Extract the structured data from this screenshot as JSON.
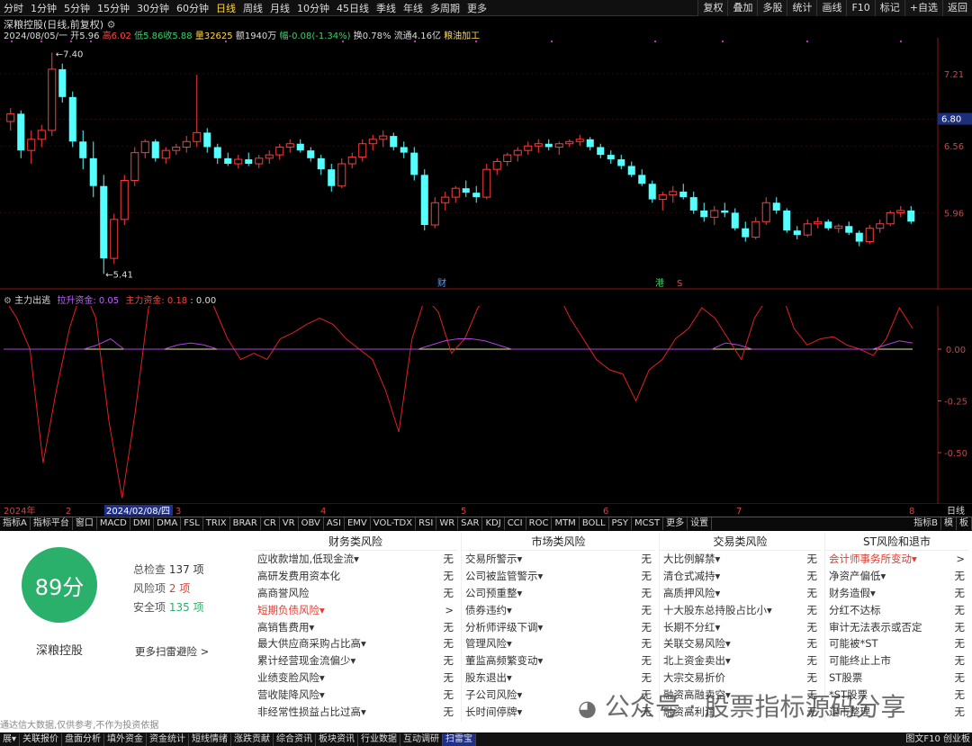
{
  "toolbar": {
    "periods": [
      "分时",
      "1分钟",
      "5分钟",
      "15分钟",
      "30分钟",
      "60分钟",
      "日线",
      "周线",
      "月线",
      "10分钟",
      "45日线",
      "季线",
      "年线",
      "多周期",
      "更多"
    ],
    "active_period": "日线",
    "right_buttons": [
      "复权",
      "叠加",
      "多股",
      "统计",
      "画线",
      "F10",
      "标记",
      "+自选",
      "返回"
    ]
  },
  "quote": {
    "title": "深粮控股(日线,前复权)",
    "date": "2024/08/05/一",
    "open": "开5.96",
    "high": "高6.02",
    "low": "低5.86",
    "close": "收5.88",
    "volume": "量32625",
    "amount": "额1940万",
    "change": "幅-0.08(-1.34%)",
    "turnover": "换0.78%",
    "float": "流通4.16亿",
    "industry": "粮油加工"
  },
  "price_axis": {
    "ticks": [
      "7.21",
      "6.80",
      "6.56",
      "5.96"
    ],
    "current_price": "6.80",
    "high_label": "7.40",
    "low_label": "5.41"
  },
  "chart_data": {
    "type": "candlestick",
    "ylim": [
      5.3,
      7.5
    ],
    "ohlc": [
      [
        6.78,
        6.9,
        6.7,
        6.85
      ],
      [
        6.85,
        6.88,
        6.45,
        6.52
      ],
      [
        6.52,
        6.7,
        6.4,
        6.62
      ],
      [
        6.62,
        6.75,
        6.55,
        6.7
      ],
      [
        6.7,
        7.4,
        6.65,
        7.25
      ],
      [
        7.25,
        7.3,
        6.95,
        7.0
      ],
      [
        7.0,
        7.05,
        6.55,
        6.6
      ],
      [
        6.6,
        6.7,
        6.35,
        6.45
      ],
      [
        6.45,
        6.6,
        6.1,
        6.2
      ],
      [
        6.2,
        6.3,
        5.41,
        5.55
      ],
      [
        5.55,
        5.95,
        5.5,
        5.9
      ],
      [
        5.9,
        6.3,
        5.85,
        6.25
      ],
      [
        6.25,
        6.55,
        6.2,
        6.5
      ],
      [
        6.5,
        6.62,
        6.45,
        6.6
      ],
      [
        6.6,
        6.62,
        6.42,
        6.45
      ],
      [
        6.45,
        6.55,
        6.4,
        6.52
      ],
      [
        6.52,
        6.58,
        6.48,
        6.55
      ],
      [
        6.55,
        6.65,
        6.5,
        6.6
      ],
      [
        6.6,
        7.2,
        6.55,
        6.68
      ],
      [
        6.68,
        6.72,
        6.5,
        6.55
      ],
      [
        6.55,
        6.58,
        6.4,
        6.45
      ],
      [
        6.45,
        6.5,
        6.38,
        6.4
      ],
      [
        6.4,
        6.48,
        6.36,
        6.44
      ],
      [
        6.44,
        6.5,
        6.38,
        6.4
      ],
      [
        6.4,
        6.48,
        6.36,
        6.45
      ],
      [
        6.45,
        6.52,
        6.4,
        6.48
      ],
      [
        6.48,
        6.58,
        6.44,
        6.55
      ],
      [
        6.55,
        6.62,
        6.5,
        6.58
      ],
      [
        6.58,
        6.62,
        6.5,
        6.52
      ],
      [
        6.52,
        6.55,
        6.42,
        6.45
      ],
      [
        6.45,
        6.48,
        6.3,
        6.35
      ],
      [
        6.35,
        6.4,
        6.15,
        6.2
      ],
      [
        6.2,
        6.45,
        6.18,
        6.4
      ],
      [
        6.4,
        6.5,
        6.36,
        6.46
      ],
      [
        6.46,
        6.62,
        6.42,
        6.58
      ],
      [
        6.58,
        6.66,
        6.52,
        6.62
      ],
      [
        6.62,
        6.7,
        6.55,
        6.65
      ],
      [
        6.65,
        6.68,
        6.52,
        6.55
      ],
      [
        6.55,
        6.6,
        6.45,
        6.5
      ],
      [
        6.5,
        6.55,
        6.25,
        6.3
      ],
      [
        6.3,
        6.35,
        5.8,
        5.85
      ],
      [
        5.85,
        6.1,
        5.82,
        6.05
      ],
      [
        6.05,
        6.15,
        5.98,
        6.1
      ],
      [
        6.1,
        6.2,
        6.05,
        6.18
      ],
      [
        6.18,
        6.25,
        6.1,
        6.14
      ],
      [
        6.14,
        6.2,
        6.05,
        6.1
      ],
      [
        6.1,
        6.4,
        6.08,
        6.35
      ],
      [
        6.35,
        6.45,
        6.3,
        6.42
      ],
      [
        6.42,
        6.5,
        6.38,
        6.48
      ],
      [
        6.48,
        6.55,
        6.42,
        6.52
      ],
      [
        6.52,
        6.6,
        6.48,
        6.56
      ],
      [
        6.56,
        6.62,
        6.5,
        6.58
      ],
      [
        6.58,
        6.62,
        6.52,
        6.55
      ],
      [
        6.55,
        6.6,
        6.48,
        6.58
      ],
      [
        6.58,
        6.62,
        6.55,
        6.6
      ],
      [
        6.6,
        6.66,
        6.56,
        6.62
      ],
      [
        6.62,
        6.64,
        6.52,
        6.55
      ],
      [
        6.55,
        6.58,
        6.45,
        6.48
      ],
      [
        6.48,
        6.52,
        6.4,
        6.44
      ],
      [
        6.44,
        6.48,
        6.35,
        6.38
      ],
      [
        6.38,
        6.42,
        6.28,
        6.3
      ],
      [
        6.3,
        6.35,
        6.2,
        6.22
      ],
      [
        6.22,
        6.25,
        6.05,
        6.08
      ],
      [
        6.08,
        6.15,
        5.98,
        6.12
      ],
      [
        6.12,
        6.2,
        6.05,
        6.15
      ],
      [
        6.15,
        6.22,
        6.08,
        6.1
      ],
      [
        6.1,
        6.15,
        5.95,
        5.98
      ],
      [
        5.98,
        6.05,
        5.88,
        5.92
      ],
      [
        5.92,
        6.02,
        5.85,
        5.98
      ],
      [
        5.98,
        6.05,
        5.92,
        5.96
      ],
      [
        5.96,
        6.0,
        5.8,
        5.82
      ],
      [
        5.82,
        5.88,
        5.7,
        5.74
      ],
      [
        5.74,
        5.92,
        5.72,
        5.88
      ],
      [
        5.88,
        6.1,
        5.85,
        6.05
      ],
      [
        6.05,
        6.1,
        5.95,
        5.98
      ],
      [
        5.98,
        6.0,
        5.78,
        5.8
      ],
      [
        5.8,
        5.84,
        5.72,
        5.76
      ],
      [
        5.76,
        5.9,
        5.74,
        5.86
      ],
      [
        5.86,
        5.92,
        5.82,
        5.88
      ],
      [
        5.88,
        5.9,
        5.8,
        5.82
      ],
      [
        5.82,
        5.86,
        5.78,
        5.84
      ],
      [
        5.84,
        5.88,
        5.76,
        5.78
      ],
      [
        5.78,
        5.8,
        5.66,
        5.7
      ],
      [
        5.7,
        5.85,
        5.68,
        5.82
      ],
      [
        5.82,
        5.9,
        5.78,
        5.86
      ],
      [
        5.86,
        5.98,
        5.84,
        5.96
      ],
      [
        5.96,
        6.02,
        5.92,
        5.98
      ],
      [
        5.98,
        6.02,
        5.86,
        5.88
      ]
    ]
  },
  "event_markers": [
    "财",
    "港",
    "S"
  ],
  "indicator": {
    "name": "主力出逃",
    "line1_label": "拉升资金: 0.05",
    "line2_label": "主力资金: 0.18",
    "line3_label": ": 0.00",
    "axis_ticks": [
      "0.00",
      "-0.25",
      "-0.50"
    ],
    "main_line": [
      0.25,
      0.15,
      0.0,
      -0.55,
      -0.2,
      0.1,
      0.3,
      0.15,
      -0.35,
      -0.72,
      -0.3,
      0.2,
      0.35,
      0.38,
      0.4,
      0.36,
      0.2,
      0.05,
      -0.05,
      -0.02,
      -0.05,
      0.05,
      0.08,
      0.12,
      0.15,
      0.12,
      0.05,
      0.0,
      -0.05,
      -0.2,
      -0.4,
      0.05,
      0.25,
      0.18,
      -0.02,
      0.05,
      0.2,
      0.28,
      0.32,
      0.35,
      0.33,
      0.22,
      0.28,
      0.15,
      0.05,
      -0.05,
      -0.1,
      -0.12,
      -0.25,
      -0.1,
      -0.05,
      0.05,
      0.1,
      0.2,
      0.15,
      0.05,
      -0.05,
      0.15,
      0.25,
      0.28,
      0.1,
      0.02,
      0.05,
      0.06,
      0.02,
      0.0,
      -0.03,
      0.05,
      0.2,
      0.1
    ],
    "flow_line": [
      0,
      0,
      0,
      0,
      0,
      0,
      0.0,
      0.02,
      0.05,
      0.0,
      0,
      0,
      0,
      0.02,
      0.03,
      0.02,
      0,
      0,
      0,
      0,
      0,
      0,
      0,
      0,
      0,
      0,
      0,
      0,
      0,
      0,
      0,
      0,
      0.02,
      0.04,
      0.05,
      0.05,
      0.04,
      0.02,
      0,
      0,
      0,
      0,
      0,
      0,
      0,
      0,
      0,
      0,
      0,
      0,
      0,
      0,
      0,
      0,
      0.03,
      0.02,
      0,
      0,
      0,
      0,
      0,
      0,
      0,
      0,
      0,
      0,
      0.02,
      0.04,
      0.03
    ]
  },
  "time_axis": {
    "labels": [
      "2024年",
      "2",
      "2024/02/08/四",
      "3",
      "4",
      "5",
      "6",
      "7",
      "8"
    ],
    "right_label": "日线"
  },
  "tabs": [
    "指标A",
    "指标平台",
    "窗口",
    "MACD",
    "DMI",
    "DMA",
    "FSL",
    "TRIX",
    "BRAR",
    "CR",
    "VR",
    "OBV",
    "ASI",
    "EMV",
    "VOL-TDX",
    "RSI",
    "WR",
    "SAR",
    "KDJ",
    "CCI",
    "ROC",
    "MTM",
    "BOLL",
    "PSY",
    "MCST",
    "更多",
    "设置"
  ],
  "tabs_right": [
    "指标B",
    "模",
    "板"
  ],
  "scan": {
    "score": "89分",
    "stock_name": "深粮控股",
    "total_label": "总检查",
    "total_value": "137 项",
    "risk_label": "风险项",
    "risk_value": "2 项",
    "safe_label": "安全项",
    "safe_value": "135 项",
    "more_link": "更多扫雷避险 >",
    "disclaimer": "通达信大数据,仅供参考,不作为投资依据",
    "columns": [
      {
        "title": "财务类风险",
        "rows": [
          {
            "name": "应收款增加,低现金流▾",
            "value": "无"
          },
          {
            "name": "高研发费用资本化",
            "value": "无"
          },
          {
            "name": "高商誉风险",
            "value": "无"
          },
          {
            "name": "短期负债风险▾",
            "value": ">",
            "hl": true
          },
          {
            "name": "高销售费用▾",
            "value": "无"
          },
          {
            "name": "最大供应商采购占比高▾",
            "value": "无"
          },
          {
            "name": "累计经营现金流偏少▾",
            "value": "无"
          },
          {
            "name": "业绩变脸风险▾",
            "value": "无"
          },
          {
            "name": "营收陡降风险▾",
            "value": "无"
          },
          {
            "name": "非经常性损益占比过高▾",
            "value": "无"
          }
        ]
      },
      {
        "title": "市场类风险",
        "rows": [
          {
            "name": "交易所警示▾",
            "value": "无"
          },
          {
            "name": "公司被监管警示▾",
            "value": "无"
          },
          {
            "name": "公司预重整▾",
            "value": "无"
          },
          {
            "name": "债券违约▾",
            "value": "无"
          },
          {
            "name": "分析师评级下调▾",
            "value": "无"
          },
          {
            "name": "管理风险▾",
            "value": "无"
          },
          {
            "name": "董监高频繁变动▾",
            "value": "无"
          },
          {
            "name": "股东退出▾",
            "value": "无"
          },
          {
            "name": "子公司风险▾",
            "value": "无"
          },
          {
            "name": "长时间停牌▾",
            "value": "无"
          }
        ]
      },
      {
        "title": "交易类风险",
        "rows": [
          {
            "name": "大比例解禁▾",
            "value": "无"
          },
          {
            "name": "清仓式减持▾",
            "value": "无"
          },
          {
            "name": "高质押风险▾",
            "value": "无"
          },
          {
            "name": "十大股东总持股占比小▾",
            "value": "无"
          },
          {
            "name": "长期不分红▾",
            "value": "无"
          },
          {
            "name": "关联交易风险▾",
            "value": "无"
          },
          {
            "name": "北上资金卖出▾",
            "value": "无"
          },
          {
            "name": "大宗交易折价",
            "value": "无"
          },
          {
            "name": "融资高融卖空▾",
            "value": "无"
          },
          {
            "name": "融资高利润",
            "value": "无"
          }
        ]
      },
      {
        "title": "ST风险和退市",
        "rows": [
          {
            "name": "会计师事务所变动▾",
            "value": ">",
            "hl": true
          },
          {
            "name": "净资产偏低▾",
            "value": "无"
          },
          {
            "name": "财务造假▾",
            "value": "无"
          },
          {
            "name": "分红不达标",
            "value": "无"
          },
          {
            "name": "审计无法表示或否定",
            "value": "无"
          },
          {
            "name": "可能被*ST",
            "value": "无"
          },
          {
            "name": "可能终止上市",
            "value": "无"
          },
          {
            "name": "ST股票",
            "value": "无"
          },
          {
            "name": "*ST股票",
            "value": "无"
          },
          {
            "name": "退市整理",
            "value": "无"
          }
        ]
      }
    ]
  },
  "watermark": "公众号 · 股票指标源码分享",
  "status_bar": [
    "展▾",
    "关联报价",
    "盘面分析",
    "填外资金",
    "资金统计",
    "短线情绪",
    "涨跌贡献",
    "综合资讯",
    "板块资讯",
    "行业数据",
    "互动调研",
    "扫雷宝"
  ],
  "status_right": "图文F10 创业板"
}
